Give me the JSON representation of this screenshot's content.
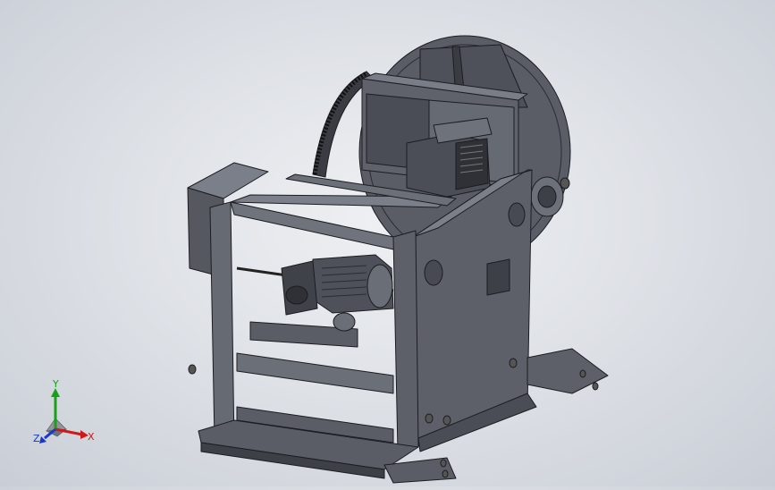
{
  "triad": {
    "x_label": "X",
    "y_label": "Y",
    "z_label": "Z",
    "x_color": "#d01818",
    "y_color": "#18a018",
    "z_color": "#1838c8"
  },
  "model": {
    "body_color": "#5d6069",
    "edge_color": "#1c1d22",
    "dark_color": "#3e4048",
    "light_color": "#7b7f89"
  }
}
